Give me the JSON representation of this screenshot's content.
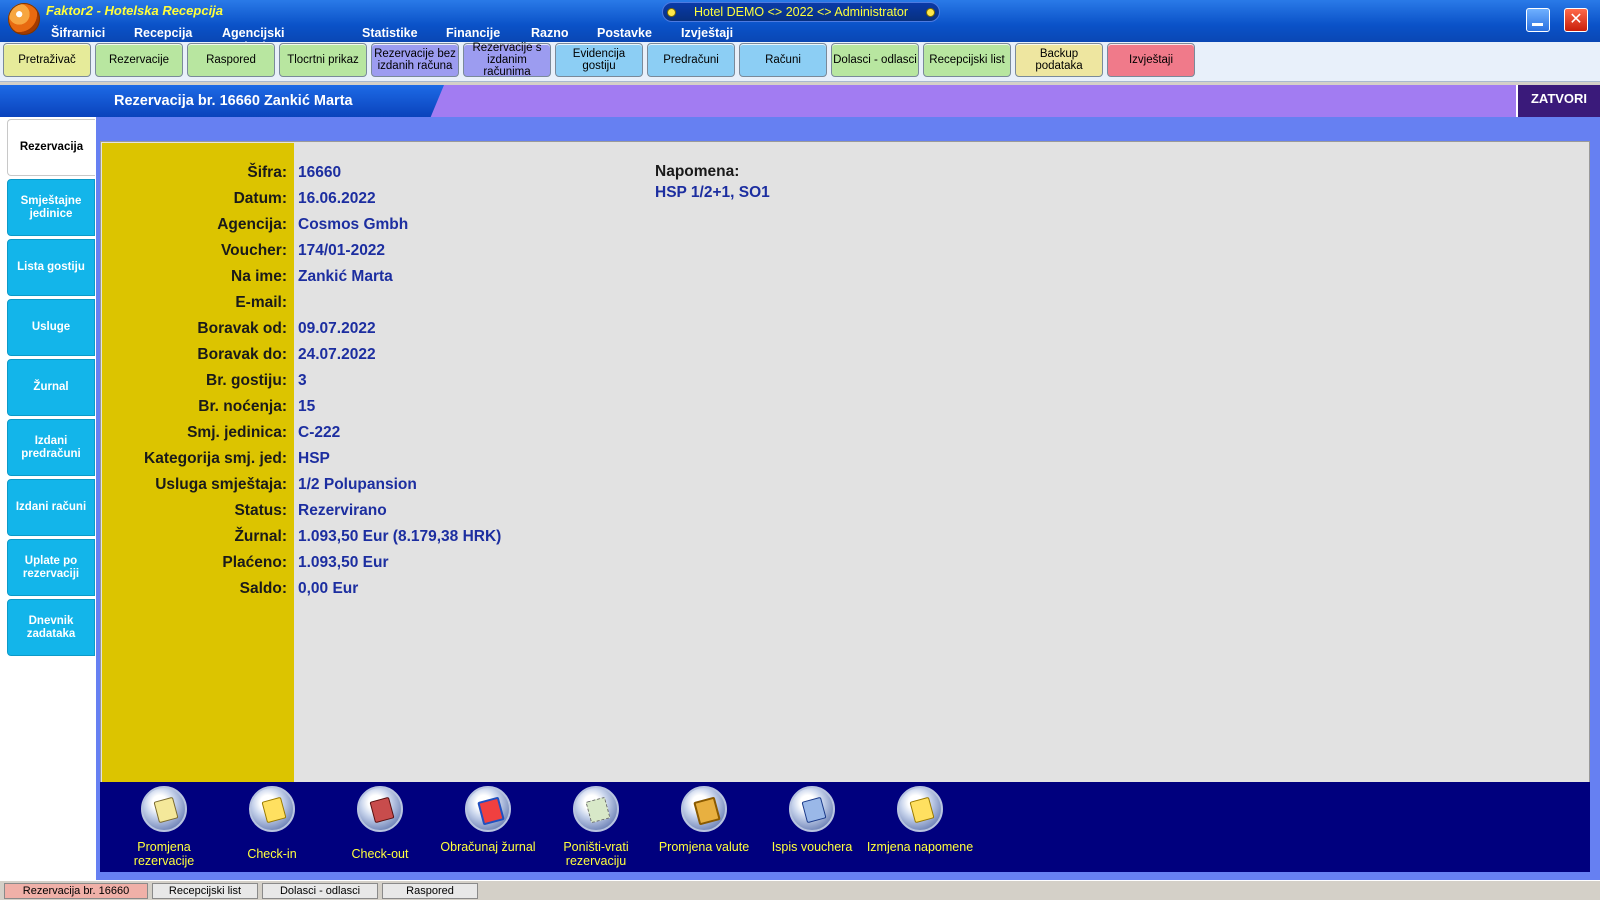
{
  "window": {
    "app_title": "Faktor2 - Hotelska Recepcija",
    "center_title": "Hotel DEMO <> 2022 <> Administrator",
    "close_glyph": "✕"
  },
  "menu": [
    "Šifrarnici",
    "Recepcija",
    "Agencijski poslovi",
    "Statistike",
    "Financije",
    "Razno",
    "Postavke",
    "Izvještaji"
  ],
  "toolbar": [
    {
      "label": "Pretraživač",
      "color": "#e6eb9a"
    },
    {
      "label": "Rezervacije",
      "color": "#b8e6a0"
    },
    {
      "label": "Raspored",
      "color": "#b8e6a0"
    },
    {
      "label": "Tlocrtni prikaz",
      "color": "#b8e6a0"
    },
    {
      "label": "Rezervacije bez izdanih računa",
      "color": "#9c9cf0"
    },
    {
      "label": "Rezervacije s izdanim računima",
      "color": "#9c9cf0"
    },
    {
      "label": "Evidencija gostiju",
      "color": "#8ccef4"
    },
    {
      "label": "Predračuni",
      "color": "#8ccef4"
    },
    {
      "label": "Računi",
      "color": "#8ccef4"
    },
    {
      "label": "Dolasci - odlasci",
      "color": "#b8e6a0"
    },
    {
      "label": "Recepcijski list",
      "color": "#b8e6a0"
    },
    {
      "label": "Backup podataka",
      "color": "#eee6a0"
    },
    {
      "label": "Izvještaji",
      "color": "#f07a8a"
    }
  ],
  "section": {
    "title": "Rezervacija br. 16660 Zankić Marta",
    "close_label": "ZATVORI"
  },
  "side_tabs": [
    "Rezervacija",
    "Smještajne jedinice",
    "Lista gostiju",
    "Usluge",
    "Žurnal",
    "Izdani predračuni",
    "Izdani računi",
    "Uplate po rezervaciji",
    "Dnevnik zadataka"
  ],
  "reservation": {
    "fields": [
      {
        "label": "Šifra:",
        "value": "16660"
      },
      {
        "label": "Datum:",
        "value": "16.06.2022"
      },
      {
        "label": "Agencija:",
        "value": "Cosmos Gmbh"
      },
      {
        "label": "Voucher:",
        "value": "174/01-2022"
      },
      {
        "label": "Na ime:",
        "value": "Zankić Marta"
      },
      {
        "label": "E-mail:",
        "value": ""
      },
      {
        "label": "Boravak od:",
        "value": "09.07.2022"
      },
      {
        "label": "Boravak do:",
        "value": "24.07.2022"
      },
      {
        "label": "Br. gostiju:",
        "value": "3"
      },
      {
        "label": "Br. noćenja:",
        "value": "15"
      },
      {
        "label": "Smj. jedinica:",
        "value": "C-222"
      },
      {
        "label": "Kategorija smj. jed:",
        "value": "HSP"
      },
      {
        "label": "Usluga smještaja:",
        "value": "1/2 Polupansion"
      },
      {
        "label": "Status:",
        "value": "Rezervirano"
      },
      {
        "label": "Žurnal:",
        "value": "1.093,50 Eur (8.179,38 HRK)"
      },
      {
        "label": "Plaćeno:",
        "value": "1.093,50 Eur"
      },
      {
        "label": "Saldo:",
        "value": "0,00 Eur"
      }
    ],
    "note_label": "Napomena:",
    "note_value": "HSP 1/2+1, SO1"
  },
  "actions": [
    {
      "label": "Promjena rezervacije",
      "icon": "edit-reservation-icon"
    },
    {
      "label": "Check-in",
      "icon": "check-in-icon"
    },
    {
      "label": "Check-out",
      "icon": "check-out-icon"
    },
    {
      "label": "Obračunaj žurnal",
      "icon": "calculate-journal-icon"
    },
    {
      "label": "Poništi-vrati rezervaciju",
      "icon": "cancel-restore-icon"
    },
    {
      "label": "Promjena valute",
      "icon": "currency-icon"
    },
    {
      "label": "Ispis vouchera",
      "icon": "print-voucher-icon"
    },
    {
      "label": "Izmjena napomene",
      "icon": "edit-note-icon"
    }
  ],
  "status_tabs": [
    "Rezervacija br. 16660",
    "Recepcijski list",
    "Dolasci - odlasci",
    "Raspored"
  ]
}
